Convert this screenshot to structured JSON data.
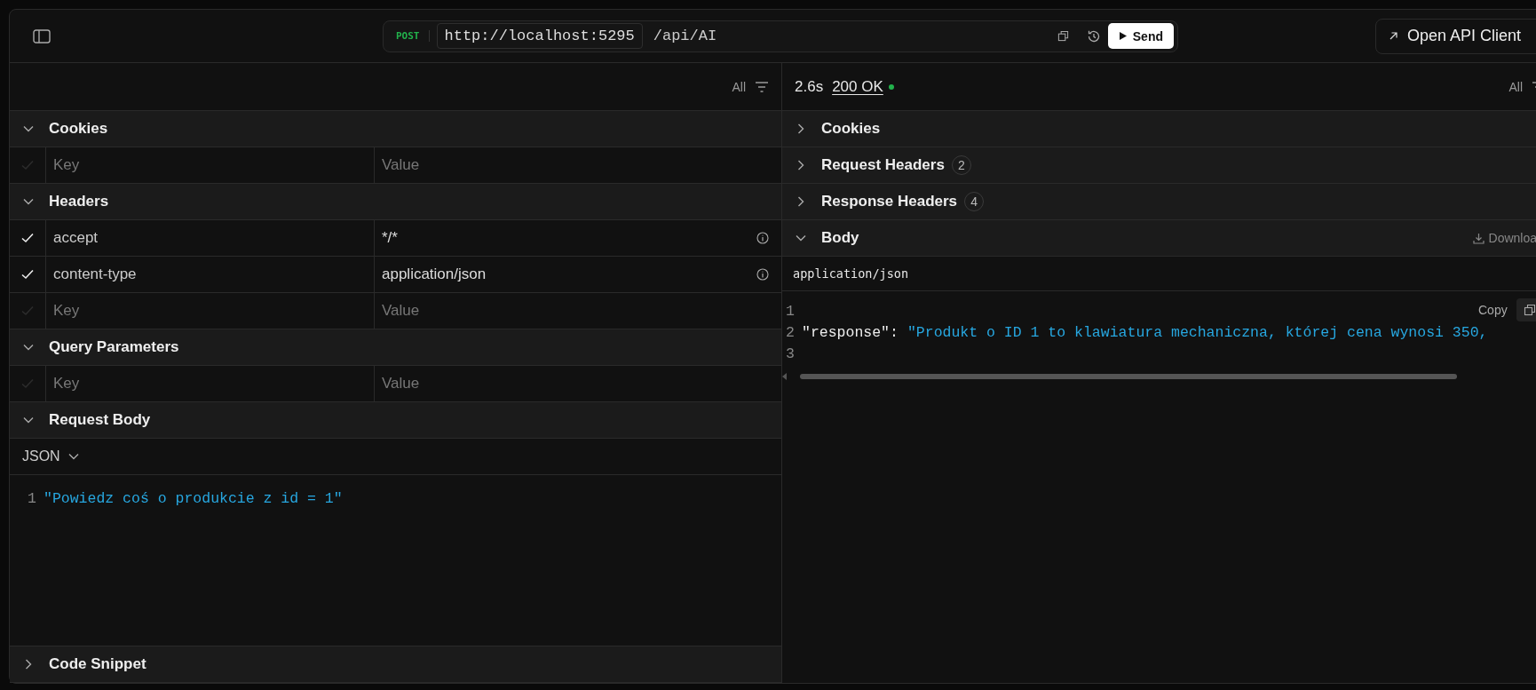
{
  "toolbar": {
    "method": "POST",
    "base_url": "http://localhost:5295",
    "path": "/api/AI",
    "send_label": "Send",
    "open_client_label": "Open API Client"
  },
  "request": {
    "filter_label": "All",
    "sections": [
      {
        "kind": "table",
        "title": "Cookies",
        "expanded": true,
        "rows": [
          {
            "kind": "empty",
            "checked": false,
            "key_placeholder": "Key",
            "value_placeholder": "Value"
          }
        ]
      },
      {
        "kind": "table",
        "title": "Headers",
        "expanded": true,
        "rows": [
          {
            "kind": "entry",
            "checked": true,
            "key": "accept",
            "value": "*/*"
          },
          {
            "kind": "entry",
            "checked": true,
            "key": "content-type",
            "value": "application/json"
          },
          {
            "kind": "empty",
            "checked": false,
            "key_placeholder": "Key",
            "value_placeholder": "Value"
          }
        ]
      },
      {
        "kind": "table",
        "title": "Query Parameters",
        "expanded": true,
        "rows": [
          {
            "kind": "empty",
            "checked": false,
            "key_placeholder": "Key",
            "value_placeholder": "Value"
          }
        ]
      },
      {
        "kind": "body",
        "title": "Request Body",
        "expanded": true,
        "format": "JSON",
        "lines": [
          {
            "number": "1",
            "text": "\"Powiedz coś o produkcie z id = 1\""
          }
        ]
      },
      {
        "kind": "plain",
        "title": "Code Snippet",
        "expanded": false
      }
    ]
  },
  "response": {
    "time": "2.6s",
    "status": "200 OK",
    "filter_label": "All",
    "sections": [
      {
        "kind": "plain",
        "title": "Cookies",
        "expanded": false
      },
      {
        "kind": "plain",
        "title": "Request Headers",
        "expanded": false,
        "count": "2"
      },
      {
        "kind": "plain",
        "title": "Response Headers",
        "expanded": false,
        "count": "4"
      },
      {
        "kind": "body",
        "title": "Body",
        "expanded": true,
        "download_label": "Downloa",
        "content_type": "application/json",
        "copy_label": "Copy",
        "lines": [
          {
            "number": "1"
          },
          {
            "number": "2",
            "tokens": [
              {
                "kind": "key",
                "text": "\"response\""
              },
              {
                "kind": "punct",
                "text": ":"
              },
              {
                "kind": "string",
                "text": "\"Produkt o ID 1 to klawiatura mechaniczna, której cena wynosi 350,"
              }
            ]
          },
          {
            "number": "3"
          }
        ]
      }
    ]
  }
}
